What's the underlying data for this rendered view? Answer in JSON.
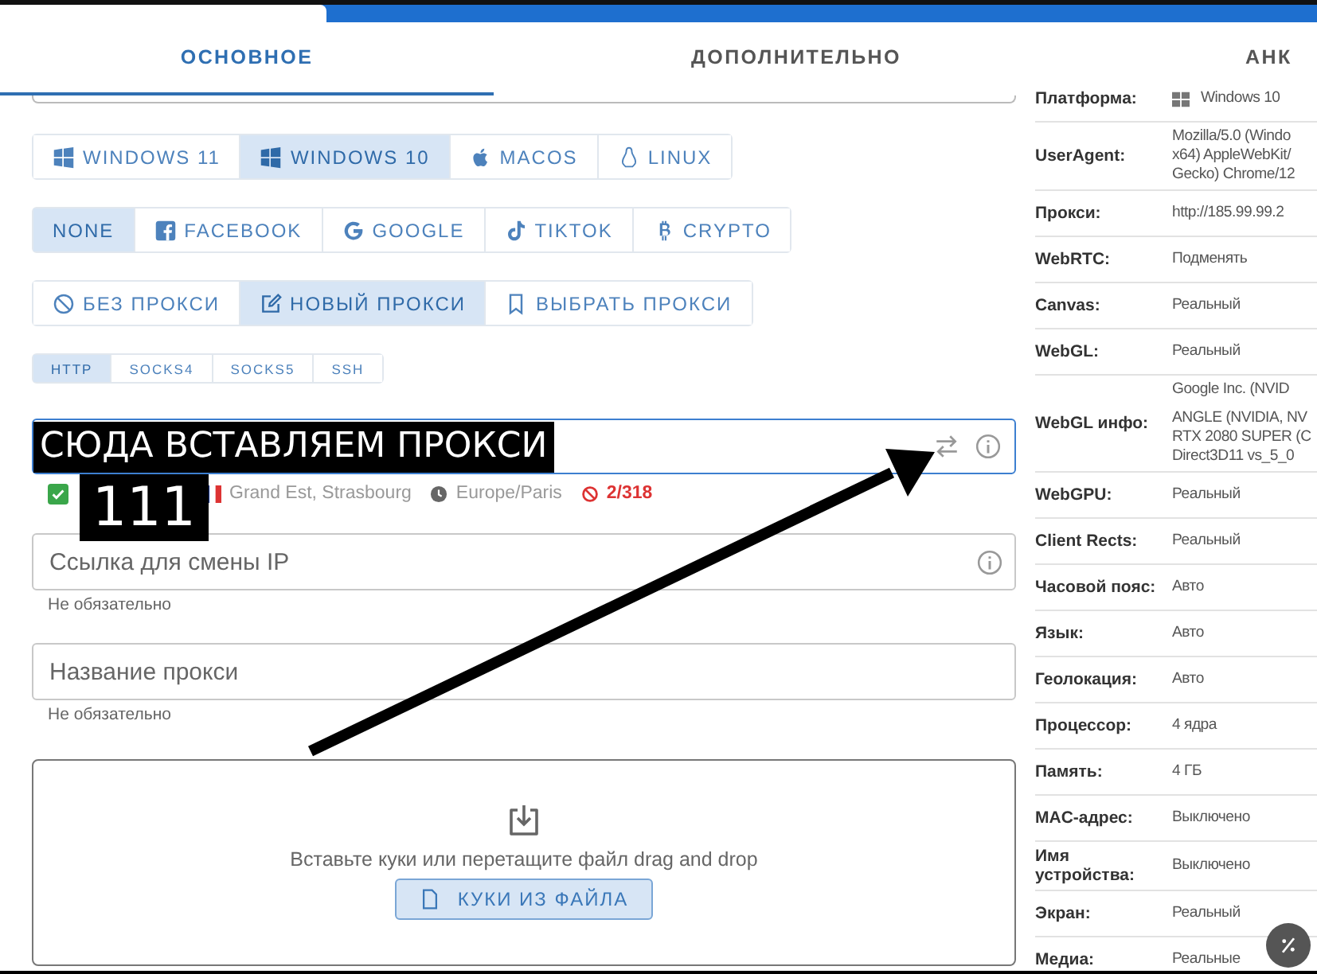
{
  "top_tabs": [
    {
      "label": "ОСНОВНОЕ",
      "selected": true
    },
    {
      "label": "ДОПОЛНИТЕЛЬНО",
      "selected": false
    },
    {
      "label": "АНК",
      "selected": false
    }
  ],
  "os_options": [
    {
      "label": "WINDOWS 11",
      "kind": "windows",
      "selected": false
    },
    {
      "label": "WINDOWS 10",
      "kind": "windows",
      "selected": true
    },
    {
      "label": "MACOS",
      "kind": "apple",
      "selected": false
    },
    {
      "label": "LINUX",
      "kind": "linux",
      "selected": false
    }
  ],
  "platform_options": [
    {
      "label": "NONE",
      "kind": "none",
      "selected": true
    },
    {
      "label": "FACEBOOK",
      "kind": "facebook",
      "selected": false
    },
    {
      "label": "GOOGLE",
      "kind": "google",
      "selected": false
    },
    {
      "label": "TIKTOK",
      "kind": "tiktok",
      "selected": false
    },
    {
      "label": "CRYPTO",
      "kind": "bitcoin",
      "selected": false
    }
  ],
  "proxy_modes": [
    {
      "label": "БЕЗ ПРОКСИ",
      "kind": "ban",
      "selected": false
    },
    {
      "label": "НОВЫЙ ПРОКСИ",
      "kind": "edit",
      "selected": true
    },
    {
      "label": "ВЫБРАТЬ ПРОКСИ",
      "kind": "bookmark",
      "selected": false
    }
  ],
  "protocols": [
    {
      "label": "HTTP",
      "selected": true
    },
    {
      "label": "SOCKS4",
      "selected": false
    },
    {
      "label": "SOCKS5",
      "selected": false
    },
    {
      "label": "SSH",
      "selected": false
    }
  ],
  "proxy_info": {
    "checked": true,
    "location": "Grand Est, Strasbourg",
    "timezone": "Europe/Paris",
    "blacklist": "2/318"
  },
  "ip_change_field": {
    "placeholder": "Ссылка для смены IP",
    "hint": "Не обязательно"
  },
  "name_field": {
    "placeholder": "Название прокси",
    "hint": "Не обязательно"
  },
  "cookies": {
    "text": "Вставьте куки или перетащите файл drag and drop",
    "button": "КУКИ ИЗ ФАЙЛА"
  },
  "summary": [
    {
      "label": "Платформа:",
      "lines": [
        "Windows 10"
      ],
      "kind": "os"
    },
    {
      "label": "UserAgent:",
      "lines": [
        "Mozilla/5.0 (Windo",
        "x64) AppleWebKit/",
        "Gecko) Chrome/12"
      ]
    },
    {
      "label": "Прокси:",
      "lines": [
        "http://185.99.99.2"
      ]
    },
    {
      "label": "WebRTC:",
      "lines": [
        "Подменять"
      ]
    },
    {
      "label": "Canvas:",
      "lines": [
        "Реальный"
      ]
    },
    {
      "label": "WebGL:",
      "lines": [
        "Реальный"
      ]
    },
    {
      "label": "WebGL инфо:",
      "lines": [
        "Google Inc. (NVID",
        "ANGLE (NVIDIA, NV",
        "RTX 2080 SUPER (C",
        "Direct3D11 vs_5_0"
      ]
    },
    {
      "label": "WebGPU:",
      "lines": [
        "Реальный"
      ]
    },
    {
      "label": "Client Rects:",
      "lines": [
        "Реальный"
      ]
    },
    {
      "label": "Часовой пояс:",
      "lines": [
        "Авто"
      ]
    },
    {
      "label": "Язык:",
      "lines": [
        "Авто"
      ]
    },
    {
      "label": "Геолокация:",
      "lines": [
        "Авто"
      ]
    },
    {
      "label": "Процессор:",
      "lines": [
        "4 ядра"
      ]
    },
    {
      "label": "Память:",
      "lines": [
        "4 ГБ"
      ]
    },
    {
      "label": "MAC-адрес:",
      "lines": [
        "Выключено"
      ]
    },
    {
      "label": "Имя устройства:",
      "lines": [
        "Выключено"
      ]
    },
    {
      "label": "Экран:",
      "lines": [
        "Реальный"
      ]
    },
    {
      "label": "Медиа:",
      "lines": [
        "Реальные"
      ]
    }
  ],
  "annotations": [
    {
      "text": "СЮДА ВСТАВЛЯЕМ ПРОКСИ",
      "kind": "label"
    },
    {
      "text": "111",
      "kind": "number"
    }
  ]
}
